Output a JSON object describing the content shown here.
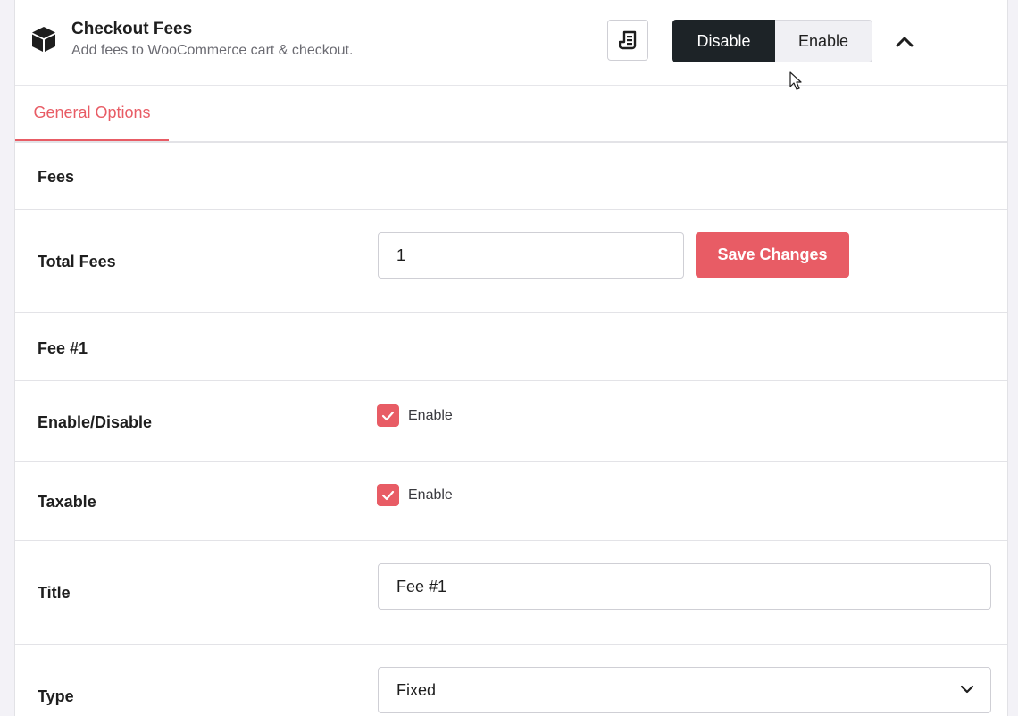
{
  "header": {
    "title": "Checkout Fees",
    "subtitle": "Add fees to WooCommerce cart & checkout.",
    "disable_label": "Disable",
    "enable_label": "Enable",
    "active_state": "Disable"
  },
  "tabs": [
    {
      "label": "General Options",
      "active": true
    }
  ],
  "sections": {
    "fees_heading": "Fees",
    "total_fees": {
      "label": "Total Fees",
      "value": "1",
      "save_label": "Save Changes"
    },
    "fee1_heading": "Fee #1",
    "enable_disable": {
      "label": "Enable/Disable",
      "checkbox_label": "Enable",
      "checked": true
    },
    "taxable": {
      "label": "Taxable",
      "checkbox_label": "Enable",
      "checked": true
    },
    "title": {
      "label": "Title",
      "value": "Fee #1"
    },
    "type": {
      "label": "Type",
      "selected": "Fixed"
    }
  },
  "colors": {
    "accent": "#e85c65",
    "dark": "#1d2327"
  },
  "icons": {
    "module": "cube-icon",
    "documentation": "document-icon",
    "collapse": "chevron-up-icon",
    "select": "chevron-down-icon",
    "checkbox": "checkmark-icon"
  }
}
